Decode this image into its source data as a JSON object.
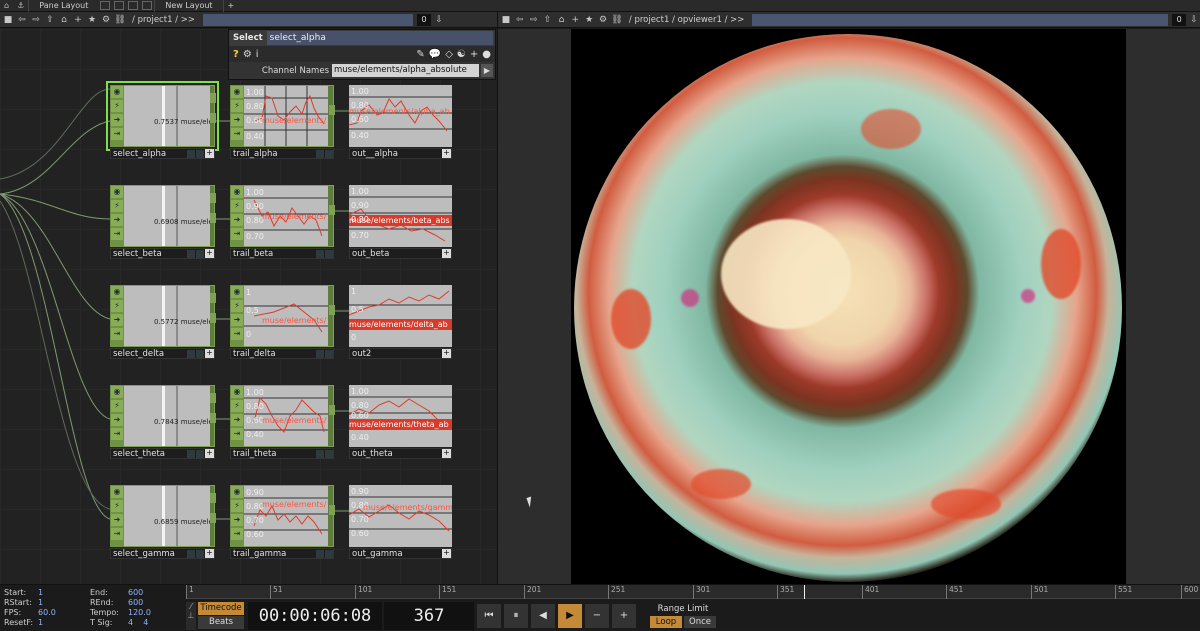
{
  "topbar": {
    "pane_layout": "Pane Layout",
    "new_layout": "New Layout",
    "plus": "+"
  },
  "left_path": {
    "path": "/ project1 / >>",
    "count": "0"
  },
  "right_path": {
    "path": "/ project1 / opviewer1 / >>",
    "count": "0"
  },
  "params": {
    "type_label": "Select",
    "node_name": "select_alpha",
    "channel_label": "Channel Names",
    "channel_value": "muse/elements/alpha_absolute"
  },
  "rows": [
    {
      "select": {
        "name": "select_alpha",
        "value": "0.7537",
        "channel": "muse/eler"
      },
      "trail": {
        "name": "trail_alpha",
        "ticks": [
          "1.00",
          "0.80",
          "0.60",
          "0.40"
        ],
        "label": "muse/elements/"
      },
      "out": {
        "name": "out__alpha",
        "ticks": [
          "1.00",
          "0.80",
          "0.60",
          "0.40"
        ],
        "label": "muse/elements/alpha_ab"
      }
    },
    {
      "select": {
        "name": "select_beta",
        "value": "0.6908",
        "channel": "muse/eler"
      },
      "trail": {
        "name": "trail_beta",
        "ticks": [
          "1.00",
          "0.90",
          "0.80",
          "0.70"
        ],
        "label": "muse/elements/"
      },
      "out": {
        "name": "out_beta",
        "ticks": [
          "1.00",
          "0.90",
          "0.80",
          "0.70"
        ],
        "label": "muse/elements/beta_abs"
      }
    },
    {
      "select": {
        "name": "select_delta",
        "value": "0.5772",
        "channel": "muse/eler"
      },
      "trail": {
        "name": "trail_delta",
        "ticks": [
          "1",
          "0.5",
          "0"
        ],
        "label": "muse/elements/"
      },
      "out": {
        "name": "out2",
        "ticks": [
          "1",
          "0.5",
          "0"
        ],
        "label": "muse/elements/delta_ab"
      }
    },
    {
      "select": {
        "name": "select_theta",
        "value": "0.7843",
        "channel": "muse/eler"
      },
      "trail": {
        "name": "trail_theta",
        "ticks": [
          "1.00",
          "0.80",
          "0.60",
          "0.40"
        ],
        "label": "muse/elements/"
      },
      "out": {
        "name": "out_theta",
        "ticks": [
          "1.00",
          "0.80",
          "0.60",
          "0.40"
        ],
        "label": "muse/elements/theta_ab"
      }
    },
    {
      "select": {
        "name": "select_gamma",
        "value": "0.6859",
        "channel": "muse/eler"
      },
      "trail": {
        "name": "trail_gamma",
        "ticks": [
          "0.90",
          "0.80",
          "0.70",
          "0.60"
        ],
        "label": "muse/elements/"
      },
      "out": {
        "name": "out_gamma",
        "ticks": [
          "0.90",
          "0.80",
          "0.70",
          "0.60"
        ],
        "label": "muse/elements/gamma_"
      }
    }
  ],
  "timeline": {
    "start_k": "Start:",
    "start_v": "1",
    "end_k": "End:",
    "end_v": "600",
    "rstart_k": "RStart:",
    "rstart_v": "1",
    "rend_k": "REnd:",
    "rend_v": "600",
    "fps_k": "FPS:",
    "fps_v": "60.0",
    "tempo_k": "Tempo:",
    "tempo_v": "120.0",
    "resetf_k": "ResetF:",
    "resetf_v": "1",
    "tsig_k": "T Sig:",
    "tsig_v1": "4",
    "tsig_v2": "4",
    "ruler": [
      "1",
      "51",
      "101",
      "151",
      "201",
      "251",
      "301",
      "351",
      "401",
      "451",
      "501",
      "551",
      "600"
    ],
    "timecode_btn": "Timecode",
    "beats_btn": "Beats",
    "timecode": "00:00:06:08",
    "frame": "367",
    "range_limit": "Range Limit",
    "loop": "Loop",
    "once": "Once"
  },
  "colors": {
    "accent": "#c48a38",
    "node_green": "#5e7d3c",
    "selected_outline": "#7fe04a",
    "trace_red": "#d93a2a"
  }
}
